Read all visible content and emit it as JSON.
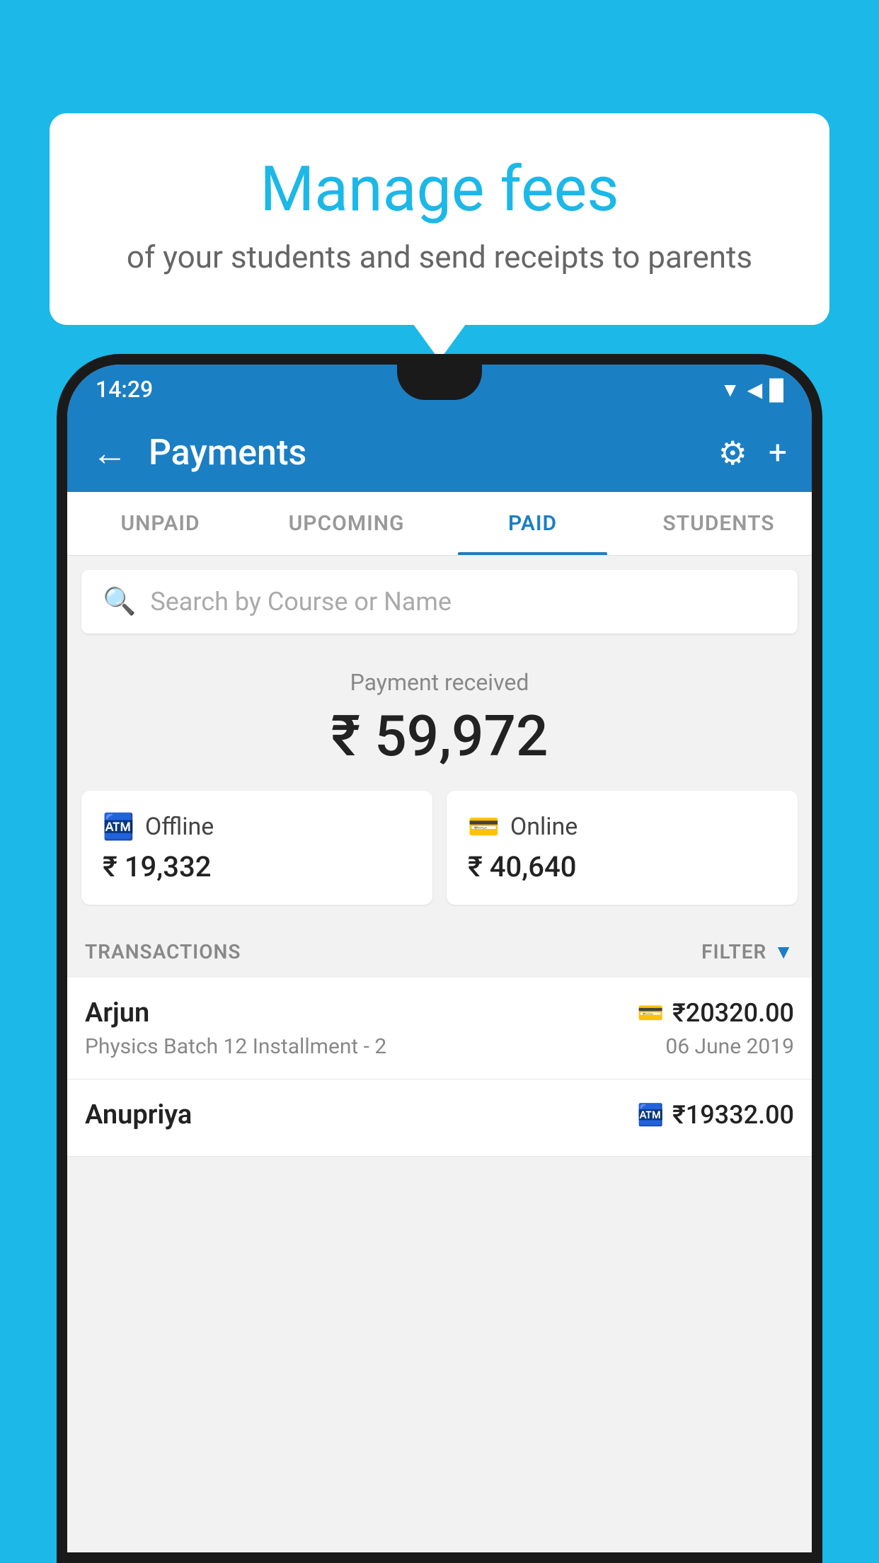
{
  "background_color": "#1bb8e8",
  "speech_bubble": {
    "title": "Manage fees",
    "subtitle": "of your students and send receipts to parents"
  },
  "status_bar": {
    "time": "14:29",
    "signal_icon": "▼◀█"
  },
  "app_bar": {
    "back_label": "←",
    "title": "Payments",
    "settings_icon": "⚙",
    "add_icon": "+"
  },
  "tabs": [
    {
      "label": "UNPAID",
      "active": false
    },
    {
      "label": "UPCOMING",
      "active": false
    },
    {
      "label": "PAID",
      "active": true
    },
    {
      "label": "STUDENTS",
      "active": false
    }
  ],
  "search": {
    "placeholder": "Search by Course or Name"
  },
  "payment_summary": {
    "label": "Payment received",
    "amount": "₹ 59,972"
  },
  "payment_cards": [
    {
      "icon": "offline",
      "label": "Offline",
      "amount": "₹ 19,332"
    },
    {
      "icon": "online",
      "label": "Online",
      "amount": "₹ 40,640"
    }
  ],
  "transactions_section": {
    "label": "TRANSACTIONS",
    "filter_label": "FILTER"
  },
  "transactions": [
    {
      "name": "Arjun",
      "course": "Physics Batch 12 Installment - 2",
      "amount": "₹20320.00",
      "date": "06 June 2019",
      "payment_type": "online"
    },
    {
      "name": "Anupriya",
      "course": "",
      "amount": "₹19332.00",
      "date": "",
      "payment_type": "offline"
    }
  ]
}
